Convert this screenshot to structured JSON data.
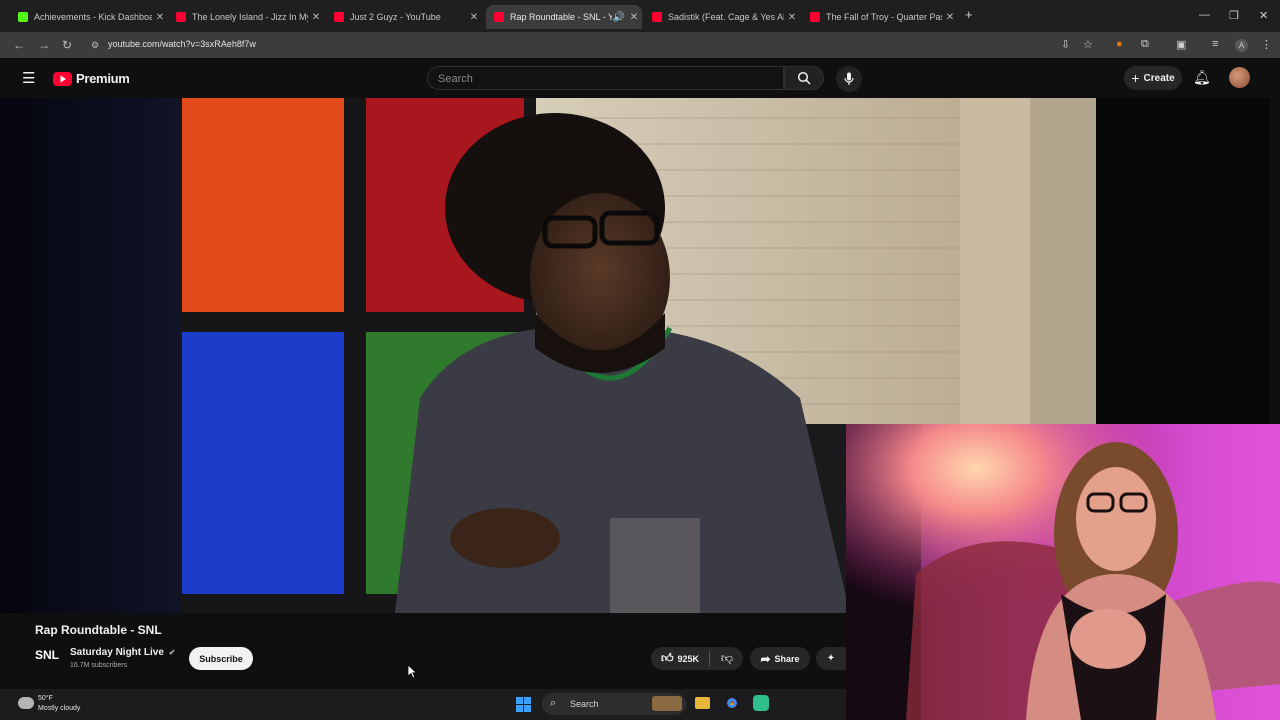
{
  "browser": {
    "tabs": [
      {
        "title": "Achievements - Kick Dashboard",
        "favicon_color": "#53fc18",
        "active": false
      },
      {
        "title": "The Lonely Island - Jizz In My P",
        "favicon_color": "#ff0033",
        "active": false
      },
      {
        "title": "Just 2 Guyz - YouTube",
        "favicon_color": "#ff0033",
        "active": false
      },
      {
        "title": "Rap Roundtable - SNL - Yo",
        "favicon_color": "#ff0033",
        "active": true
      },
      {
        "title": "Sadistik (Feat. Cage & Yes Alex",
        "favicon_color": "#ff0033",
        "active": false
      },
      {
        "title": "The Fall of Troy - Quarter Past",
        "favicon_color": "#ff0033",
        "active": false
      }
    ],
    "new_tab": "+",
    "url": "youtube.com/watch?v=3sxRAeh8f7w",
    "profile_initial": "A"
  },
  "youtube": {
    "logo_text": "Premium",
    "search_placeholder": "Search",
    "create_label": "Create",
    "accent": "#ff0033"
  },
  "video": {
    "title": "Rap Roundtable - SNL",
    "channel": "Saturday Night Live",
    "channel_logo": "SNL",
    "subscribers": "16.7M subscribers",
    "subscribe_label": "Subscribe",
    "likes": "925K",
    "share_label": "Share"
  },
  "taskbar": {
    "temperature": "50°F",
    "weather_desc": "Mostly cloudy",
    "search_label": "Search"
  }
}
